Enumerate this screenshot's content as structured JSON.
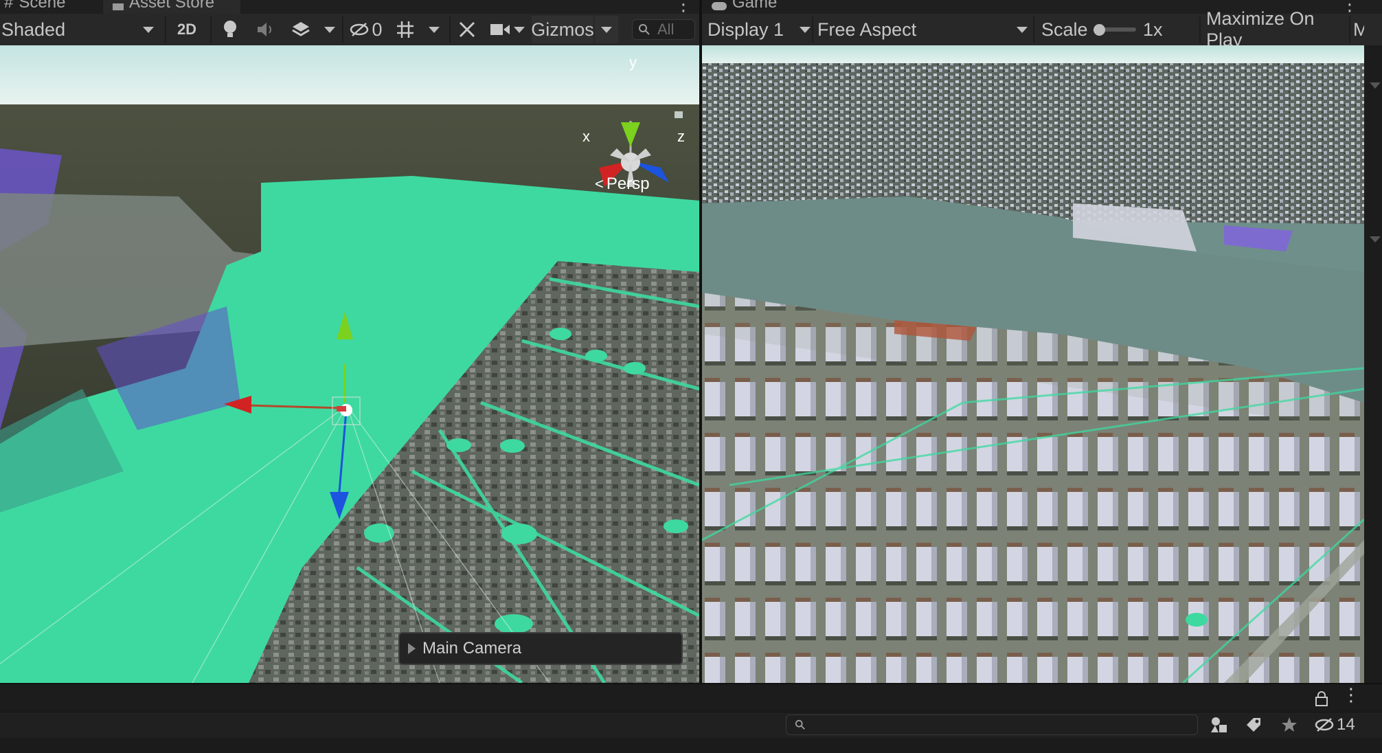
{
  "scene_tab": {
    "label": "Scene"
  },
  "asset_store_tab": {
    "label": "Asset Store"
  },
  "game_tab": {
    "label": "Game"
  },
  "scene_toolbar": {
    "draw_mode": "Shaded",
    "mode_2d": "2D",
    "hidden_count": "0",
    "gizmos_label": "Gizmos",
    "search_placeholder": "All"
  },
  "scene_view": {
    "gizmo_y": "y",
    "gizmo_x": "x",
    "gizmo_z": "z",
    "projection_label": "Persp",
    "camera_label": "Main Camera"
  },
  "game_toolbar": {
    "display": "Display 1",
    "aspect": "Free Aspect",
    "scale_label": "Scale",
    "scale_value": "1x",
    "maximize_label": "Maximize On Play",
    "overflow_text": "M"
  },
  "bottom_panel": {
    "hidden_count": "14"
  },
  "colors": {
    "editor_bg": "#191919",
    "toolbar_bg": "#282828",
    "gizmo_y": "#7bd11d",
    "gizmo_x": "#d12323",
    "gizmo_z": "#1c54e0",
    "terrain_green": "#3ed9a0"
  }
}
